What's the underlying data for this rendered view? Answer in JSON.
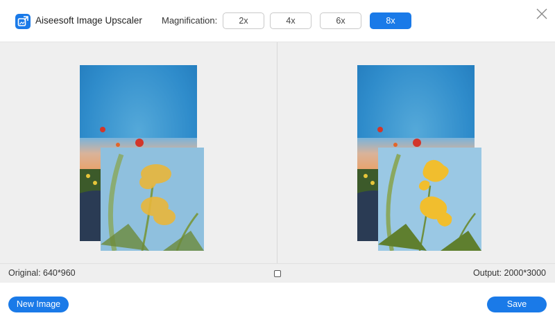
{
  "header": {
    "app_title": "Aiseesoft Image Upscaler",
    "magnification_label": "Magnification:",
    "magnification_options": [
      "2x",
      "4x",
      "6x",
      "8x"
    ],
    "selected_magnification": "8x",
    "close_icon": "close-icon",
    "logo_icon": "image-upscale-icon"
  },
  "info": {
    "original": "Original: 640*960",
    "output": "Output: 2000*3000",
    "compare_icon": "compare-icon"
  },
  "footer": {
    "new_image_label": "New Image",
    "save_label": "Save"
  },
  "colors": {
    "accent": "#1a7ae8",
    "preview_bg": "#efefef"
  }
}
